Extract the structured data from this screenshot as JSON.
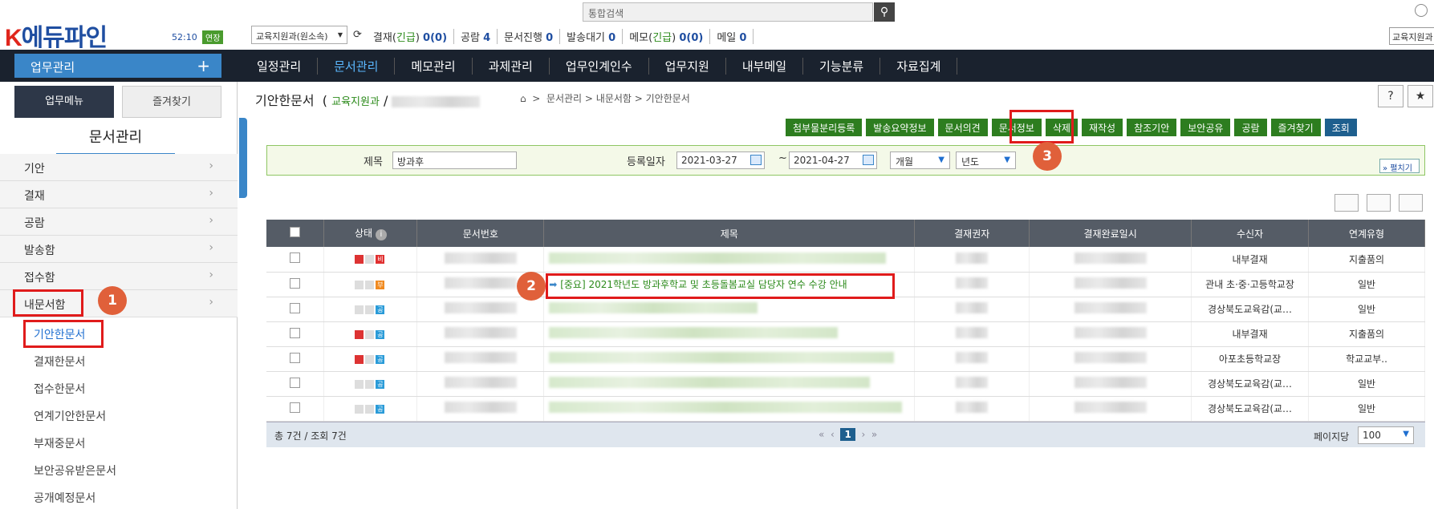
{
  "header": {
    "logo_k": "K",
    "logo_rest": "에듀파인",
    "timer": "52:10",
    "extend_label": "연장",
    "dept_select": "교육지원과(원소속)",
    "search_placeholder": "통합검색",
    "right_select": "교육지원과",
    "stats": [
      {
        "label": "결재(",
        "accent": "긴급",
        "rest": ")",
        "value": "0(0)"
      },
      {
        "label": "공람",
        "value": "4"
      },
      {
        "label": "문서진행",
        "value": "0"
      },
      {
        "label": "발송대기",
        "value": "0"
      },
      {
        "label": "메모(",
        "accent": "긴급",
        "rest": ")",
        "value": "0(0)"
      },
      {
        "label": "메일",
        "value": "0"
      }
    ]
  },
  "nav": {
    "work_label": "업무관리",
    "items": [
      "일정관리",
      "문서관리",
      "메모관리",
      "과제관리",
      "업무인계인수",
      "업무지원",
      "내부메일",
      "기능분류",
      "자료집계"
    ],
    "active_index": 1
  },
  "sidebar": {
    "tab_menu": "업무메뉴",
    "tab_fav": "즐겨찾기",
    "title": "문서관리",
    "items": [
      "기안",
      "결재",
      "공람",
      "발송함",
      "접수함",
      "내문서함"
    ],
    "subitems": [
      "기안한문서",
      "결재한문서",
      "접수한문서",
      "연계기안한문서",
      "부재중문서",
      "보안공유받은문서",
      "공개예정문서"
    ]
  },
  "page": {
    "title": "기안한문서",
    "dept": "교육지원과",
    "breadcrumb": "문서관리 > 내문서함 > 기안한문서"
  },
  "toolbar": [
    "첨부물분리등록",
    "발송요약정보",
    "문서의견",
    "문서정보",
    "삭제",
    "재작성",
    "참조기안",
    "보안공유",
    "공람",
    "즐겨찾기",
    "조회"
  ],
  "filter": {
    "title_label": "제목",
    "title_value": "방과후",
    "date_label": "등록일자",
    "date_from": "2021-03-27",
    "tilde": "~",
    "date_to": "2021-04-27",
    "period": "개월",
    "year": "년도",
    "expand": "펼치기"
  },
  "table": {
    "headers": [
      "상태",
      "문서번호",
      "제목",
      "결재권자",
      "결재완료일시",
      "수신자",
      "연계유형"
    ],
    "highlighted_title": "[중요] 2021학년도 방과후학교 및 초등돌봄교실 담당자 연수 수강 안내",
    "rows": [
      {
        "badge": "비",
        "badge_color": "#e03030",
        "receiver": "내부결재",
        "link": "지출품의"
      },
      {
        "badge": "부",
        "badge_color": "#f08a20",
        "receiver": "관내 초·중·고등학교장",
        "link": "일반"
      },
      {
        "badge": "공",
        "badge_color": "#2a9bd8",
        "receiver": "경상북도교육감(교…",
        "link": "일반"
      },
      {
        "badge": "공",
        "badge_color": "#2a9bd8",
        "receiver": "내부결재",
        "link": "지출품의"
      },
      {
        "badge": "공",
        "badge_color": "#2a9bd8",
        "receiver": "아포초등학교장",
        "link": "학교교부.."
      },
      {
        "badge": "공",
        "badge_color": "#2a9bd8",
        "receiver": "경상북도교육감(교…",
        "link": "일반"
      },
      {
        "badge": "공",
        "badge_color": "#2a9bd8",
        "receiver": "경상북도교육감(교…",
        "link": "일반"
      }
    ]
  },
  "footer": {
    "total": "총 7건 / 조회 7건",
    "page": "1",
    "per_page_label": "페이지당",
    "per_page": "100"
  },
  "annotations": [
    "1",
    "2",
    "3"
  ]
}
